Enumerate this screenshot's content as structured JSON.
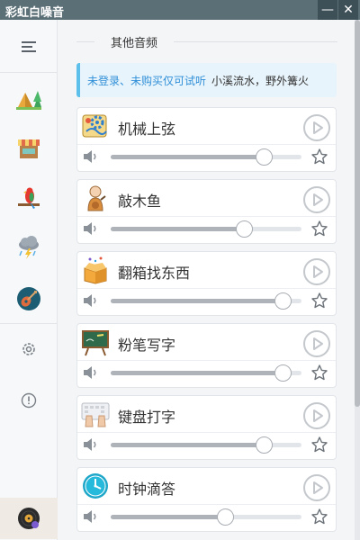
{
  "window": {
    "title": "彩虹白噪音",
    "min_label": "—",
    "close_label": "✕"
  },
  "sidebar": {
    "items": [
      {
        "name": "menu-icon"
      },
      {
        "name": "camping-icon"
      },
      {
        "name": "market-stall-icon"
      },
      {
        "name": "parrot-icon"
      },
      {
        "name": "thunderstorm-icon"
      },
      {
        "name": "guitar-icon"
      },
      {
        "name": "settings-icon"
      },
      {
        "name": "info-icon"
      },
      {
        "name": "vinyl-record-icon"
      }
    ]
  },
  "main": {
    "section_title": "其他音频",
    "notice": {
      "prefix": "未登录、未购买仅可试听",
      "tracks": "小溪流水，野外篝火"
    },
    "sounds": [
      {
        "name": "机械上弦",
        "icon": "mechanical-gear-icon",
        "volume": 0.8
      },
      {
        "name": "敲木鱼",
        "icon": "monk-woodfish-icon",
        "volume": 0.7
      },
      {
        "name": "翻箱找东西",
        "icon": "open-box-icon",
        "volume": 0.9
      },
      {
        "name": "粉笔写字",
        "icon": "chalkboard-icon",
        "volume": 0.9
      },
      {
        "name": "键盘打字",
        "icon": "keyboard-typing-icon",
        "volume": 0.8
      },
      {
        "name": "时钟滴答",
        "icon": "clock-icon",
        "volume": 0.6
      }
    ]
  },
  "colors": {
    "titlebar": "#5b6f77",
    "notice_accent": "#5cc0ea",
    "notice_text": "#2f8fd8",
    "slider_fill": "#aeb3b9"
  }
}
